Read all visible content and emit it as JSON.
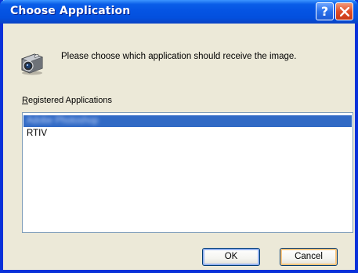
{
  "window": {
    "title": "Choose Application",
    "help_symbol": "?"
  },
  "message": {
    "text": "Please choose which application should receive the image."
  },
  "list": {
    "label_prefix": "R",
    "label_rest": "egistered Applications",
    "items": [
      {
        "label": "Adobe Photoshop",
        "selected": true,
        "obscured": true
      },
      {
        "label": "RTIV",
        "selected": false,
        "obscured": false
      }
    ]
  },
  "buttons": {
    "ok_label": "OK",
    "cancel_label": "Cancel"
  },
  "icons": {
    "camera": "camera-icon",
    "help": "help-icon",
    "close": "close-icon"
  },
  "colors": {
    "titlebar": "#0554e3",
    "selection": "#316ac5",
    "close": "#df4d27",
    "window_bg": "#ece9d8"
  }
}
